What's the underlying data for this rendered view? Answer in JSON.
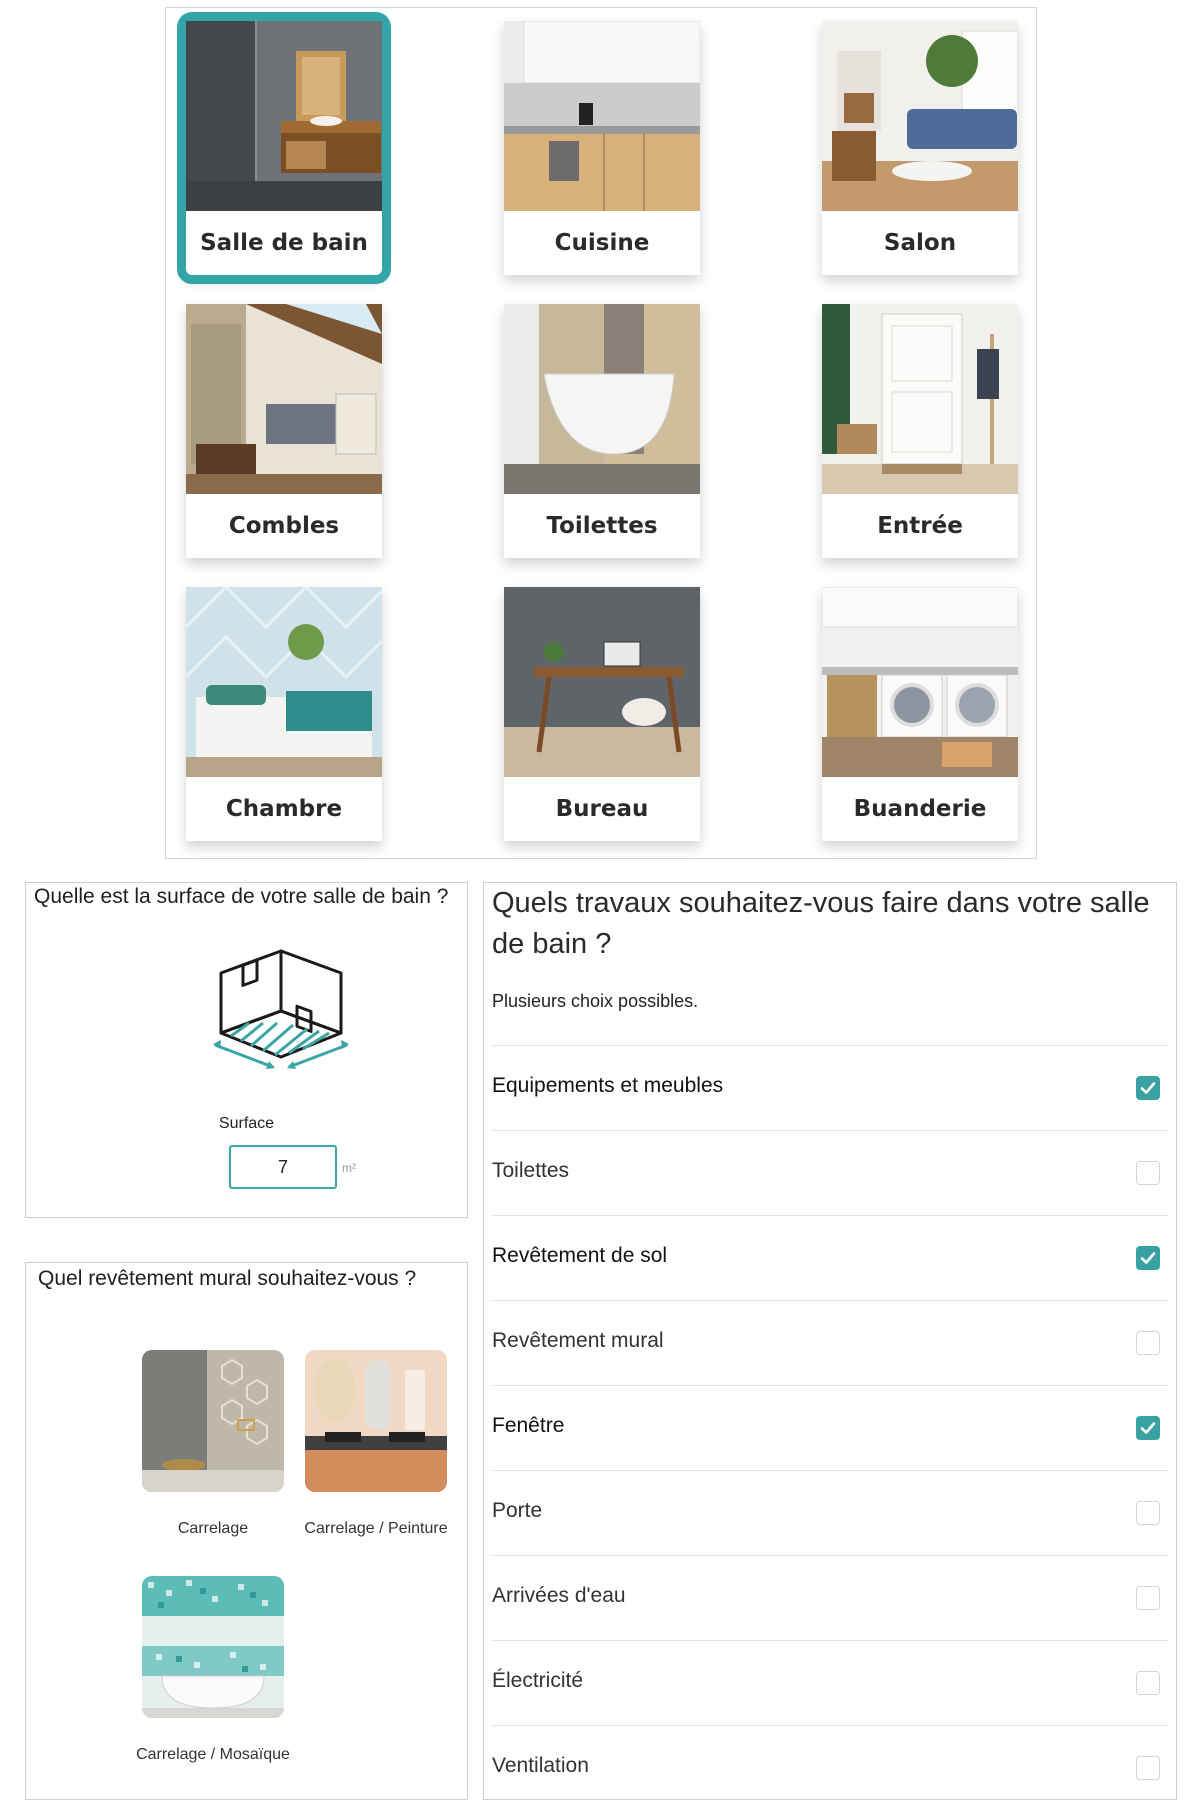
{
  "rooms": [
    {
      "label": "Salle de bain",
      "selected": true
    },
    {
      "label": "Cuisine",
      "selected": false
    },
    {
      "label": "Salon",
      "selected": false
    },
    {
      "label": "Combles",
      "selected": false
    },
    {
      "label": "Toilettes",
      "selected": false
    },
    {
      "label": "Entrée",
      "selected": false
    },
    {
      "label": "Chambre",
      "selected": false
    },
    {
      "label": "Bureau",
      "selected": false
    },
    {
      "label": "Buanderie",
      "selected": false
    }
  ],
  "surface": {
    "question": "Quelle est la surface de votre salle de bain ?",
    "caption": "Surface",
    "value": "7",
    "unit": "m²",
    "icon": "room-area-icon"
  },
  "wall": {
    "question": "Quel revêtement mural souhaitez-vous ?",
    "options": [
      {
        "label": "Carrelage"
      },
      {
        "label": "Carrelage / Peinture"
      },
      {
        "label": "Carrelage / Mosaïque"
      }
    ]
  },
  "works": {
    "title": "Quels travaux souhaitez-vous faire dans votre salle de bain ?",
    "hint": "Plusieurs choix possibles.",
    "accent": "#3aa1a3",
    "items": [
      {
        "label": "Equipements et meubles",
        "checked": true
      },
      {
        "label": "Toilettes",
        "checked": false
      },
      {
        "label": "Revêtement de sol",
        "checked": true
      },
      {
        "label": "Revêtement mural",
        "checked": false
      },
      {
        "label": "Fenêtre",
        "checked": true
      },
      {
        "label": "Porte",
        "checked": false
      },
      {
        "label": "Arrivées d'eau",
        "checked": false
      },
      {
        "label": "Électricité",
        "checked": false
      },
      {
        "label": "Ventilation",
        "checked": false
      }
    ]
  }
}
